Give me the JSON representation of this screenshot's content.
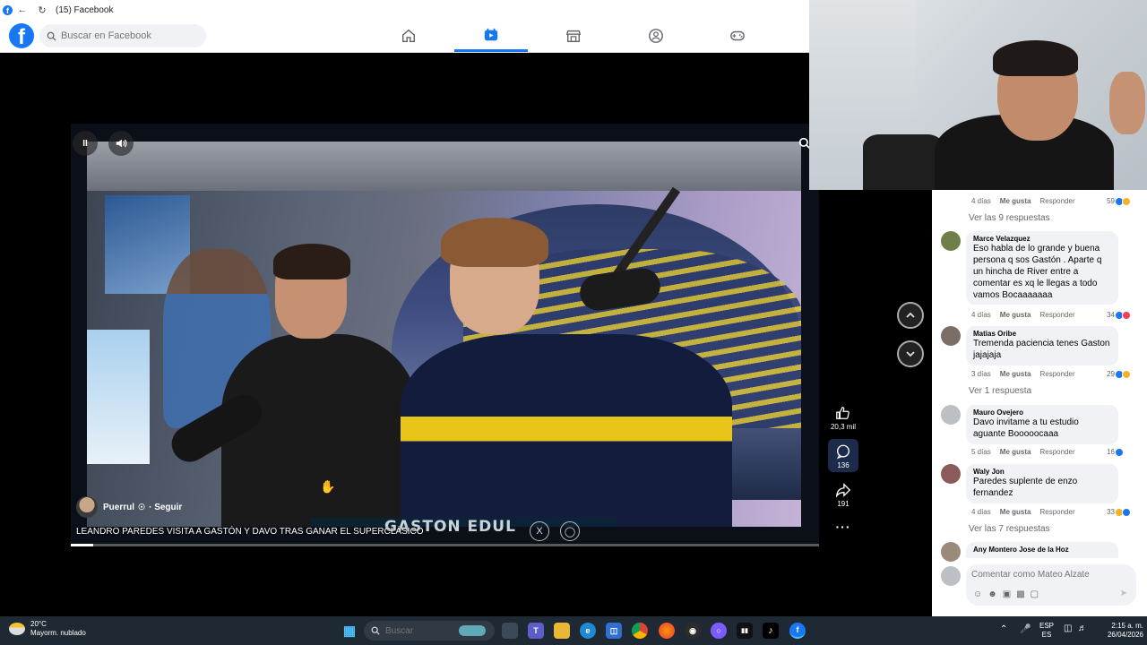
{
  "browser": {
    "title": "(15) Facebook"
  },
  "header": {
    "search_placeholder": "Buscar en Facebook",
    "nav": [
      {
        "name": "home-icon"
      },
      {
        "name": "video-icon",
        "active": true
      },
      {
        "name": "marketplace-icon"
      },
      {
        "name": "groups-icon"
      },
      {
        "name": "gaming-icon"
      }
    ]
  },
  "video": {
    "author": "Puerrul",
    "verified_mark": "☉",
    "follow": "· Seguir",
    "caption": "LEANDRO PAREDES VISITA A GASTÓN Y DAVO TRAS GANAR EL SUPERCLÁSICO",
    "overlay_brand": "GASTON  EDUL",
    "progress": 0.03
  },
  "actions": {
    "likes": "20,3 mil",
    "comments": "136",
    "shares": "191"
  },
  "comments": {
    "top_meta": {
      "time": "4 días",
      "like": "Me gusta",
      "reply": "Responder",
      "count": "59"
    },
    "top_replies": "Ver las 9 respuestas",
    "items": [
      {
        "author": "Marce Velazquez",
        "text": "Eso habla de lo grande y buena persona q sos Gastón . Aparte q un hincha de River entre a comentar es xq le llegas a todo vamos Bocaaaaaaa",
        "time": "4 días",
        "like": "Me gusta",
        "reply": "Responder",
        "count": "34",
        "replies": ""
      },
      {
        "author": "Matias Oribe",
        "text": "Tremenda paciencia tenes Gaston jajajaja",
        "time": "3 días",
        "like": "Me gusta",
        "reply": "Responder",
        "count": "29",
        "replies": "Ver 1 respuesta"
      },
      {
        "author": "Mauro Ovejero",
        "text": "Davo invitame a tu estudio aguante Booooocaaa",
        "time": "5 días",
        "like": "Me gusta",
        "reply": "Responder",
        "count": "16",
        "replies": ""
      },
      {
        "author": "Waly Jon",
        "text": "Paredes suplente de enzo fernandez",
        "time": "4 días",
        "like": "Me gusta",
        "reply": "Responder",
        "count": "33",
        "replies": "Ver las 7 respuestas"
      },
      {
        "author": "Any Montero Jose de la Hoz",
        "text": "",
        "time": "",
        "like": "",
        "reply": "",
        "count": "",
        "replies": ""
      }
    ],
    "input_placeholder": "Comentar como Mateo Alzate"
  },
  "taskbar": {
    "weather_temp": "20°C",
    "weather_desc": "Mayorm. nublado",
    "search_placeholder": "Buscar",
    "lang_top": "ESP",
    "lang_bottom": "ES",
    "time": "2:15 a. m.",
    "date": "26/04/2026"
  },
  "colors": {
    "facebook_blue": "#1877f2",
    "taskbar": "#1f2933"
  }
}
